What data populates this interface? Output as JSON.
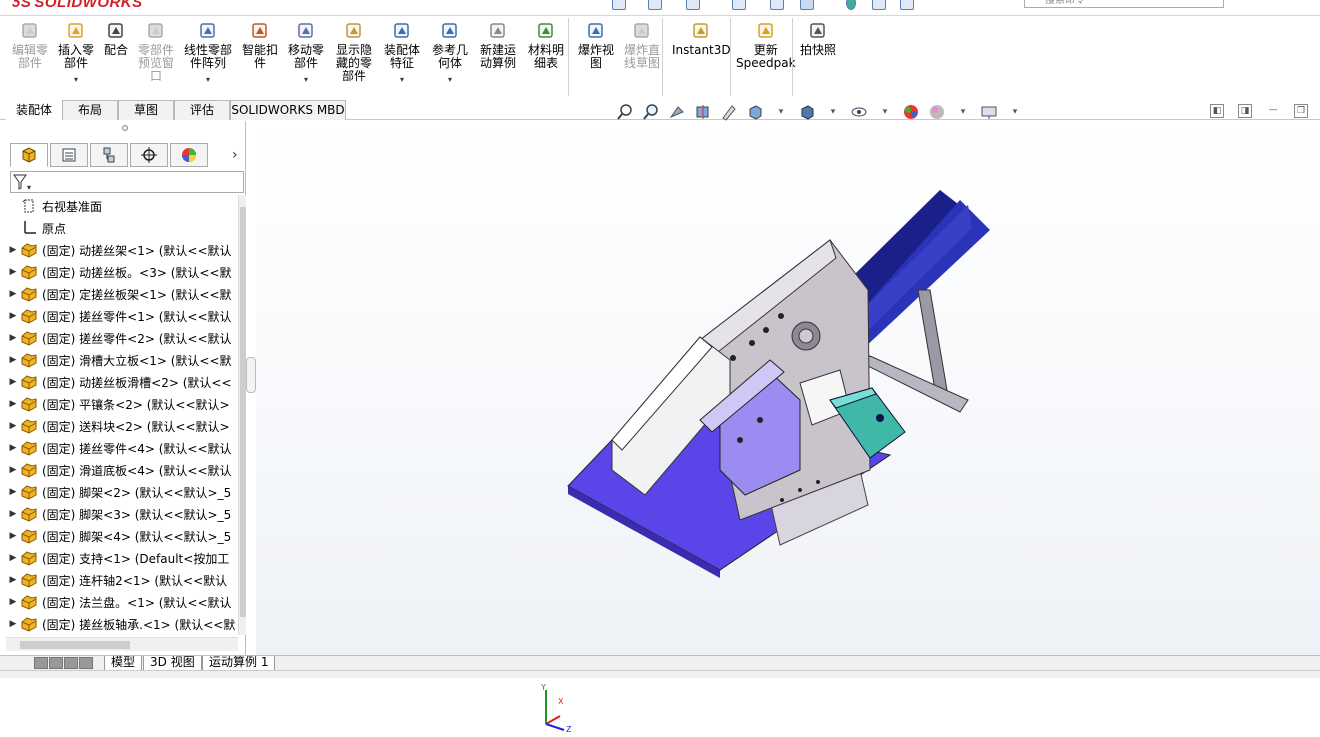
{
  "app": {
    "name": "SOLIDWORKS",
    "search_placeholder": "搜索命令"
  },
  "toolbar": {
    "items": [
      {
        "label_lines": [
          "编辑零",
          "部件"
        ],
        "disabled": true,
        "icon": "edit-component-icon"
      },
      {
        "label_lines": [
          "插入零",
          "部件"
        ],
        "disabled": false,
        "icon": "insert-component-icon",
        "dropdown": true
      },
      {
        "label_lines": [
          "配合"
        ],
        "disabled": false,
        "icon": "mate-icon"
      },
      {
        "label_lines": [
          "零部件",
          "预览窗",
          "口"
        ],
        "disabled": true,
        "icon": "component-preview-icon"
      },
      {
        "label_lines": [
          "线性零部",
          "件阵列"
        ],
        "disabled": false,
        "icon": "linear-pattern-icon",
        "dropdown": true
      },
      {
        "label_lines": [
          "智能扣",
          "件"
        ],
        "disabled": false,
        "icon": "smart-fasteners-icon"
      },
      {
        "label_lines": [
          "移动零",
          "部件"
        ],
        "disabled": false,
        "icon": "move-component-icon",
        "dropdown": true
      },
      {
        "label_lines": [
          "显示隐",
          "藏的零",
          "部件"
        ],
        "disabled": false,
        "icon": "show-hidden-icon"
      },
      {
        "label_lines": [
          "装配体",
          "特征"
        ],
        "disabled": false,
        "icon": "assembly-features-icon",
        "dropdown": true
      },
      {
        "label_lines": [
          "参考几",
          "何体"
        ],
        "disabled": false,
        "icon": "reference-geometry-icon",
        "dropdown": true
      },
      {
        "label_lines": [
          "新建运",
          "动算例"
        ],
        "disabled": false,
        "icon": "new-motion-study-icon"
      },
      {
        "label_lines": [
          "材料明",
          "细表"
        ],
        "disabled": false,
        "icon": "bom-icon"
      },
      {
        "label_lines": [
          "爆炸视",
          "图"
        ],
        "disabled": false,
        "icon": "exploded-view-icon"
      },
      {
        "label_lines": [
          "爆炸直",
          "线草图"
        ],
        "disabled": true,
        "icon": "explode-line-sketch-icon"
      },
      {
        "label_lines": [
          "Instant3D"
        ],
        "disabled": false,
        "icon": "instant3d-icon"
      },
      {
        "label_lines": [
          "更新",
          "Speedpak"
        ],
        "disabled": false,
        "icon": "speedpak-icon"
      },
      {
        "label_lines": [
          "拍快照"
        ],
        "disabled": false,
        "icon": "snapshot-icon"
      }
    ]
  },
  "command_tabs": [
    "装配体",
    "布局",
    "草图",
    "评估",
    "SOLIDWORKS MBD"
  ],
  "feature_tree": {
    "items": [
      {
        "label": "右视基准面",
        "icon": "plane-icon",
        "expandable": false
      },
      {
        "label": "原点",
        "icon": "origin-icon",
        "expandable": false
      },
      {
        "label": "(固定) 动搓丝架<1> (默认<<默认",
        "icon": "part-icon",
        "expandable": true
      },
      {
        "label": "(固定) 动搓丝板。<3> (默认<<默",
        "icon": "part-icon",
        "expandable": true
      },
      {
        "label": "(固定) 定搓丝板架<1> (默认<<默",
        "icon": "part-icon",
        "expandable": true
      },
      {
        "label": "(固定) 搓丝零件<1> (默认<<默认",
        "icon": "part-icon",
        "expandable": true
      },
      {
        "label": "(固定) 搓丝零件<2> (默认<<默认",
        "icon": "part-icon",
        "expandable": true
      },
      {
        "label": "(固定) 滑槽大立板<1> (默认<<默",
        "icon": "part-icon",
        "expandable": true
      },
      {
        "label": "(固定) 动搓丝板滑槽<2> (默认<<",
        "icon": "part-icon",
        "expandable": true
      },
      {
        "label": "(固定) 平镶条<2> (默认<<默认>",
        "icon": "part-icon",
        "expandable": true
      },
      {
        "label": "(固定) 送料块<2> (默认<<默认>",
        "icon": "part-icon",
        "expandable": true
      },
      {
        "label": "(固定) 搓丝零件<4> (默认<<默认",
        "icon": "part-icon",
        "expandable": true
      },
      {
        "label": "(固定) 滑道底板<4> (默认<<默认",
        "icon": "part-icon",
        "expandable": true
      },
      {
        "label": "(固定) 脚架<2> (默认<<默认>_5",
        "icon": "part-icon",
        "expandable": true
      },
      {
        "label": "(固定) 脚架<3> (默认<<默认>_5",
        "icon": "part-icon",
        "expandable": true
      },
      {
        "label": "(固定) 脚架<4> (默认<<默认>_5",
        "icon": "part-icon",
        "expandable": true
      },
      {
        "label": "(固定) 支持<1> (Default<按加工",
        "icon": "part-icon",
        "expandable": true
      },
      {
        "label": "(固定) 连杆轴2<1> (默认<<默认",
        "icon": "part-icon",
        "expandable": true
      },
      {
        "label": "(固定) 法兰盘。<1> (默认<<默认",
        "icon": "part-icon",
        "expandable": true
      },
      {
        "label": "(固定) 搓丝板轴承.<1> (默认<<默",
        "icon": "part-icon",
        "expandable": true
      }
    ]
  },
  "bottom_tabs": [
    "模型",
    "3D 视图",
    "运动算例 1"
  ],
  "colors": {
    "accent": "#d31f26",
    "tree_part": "#f0b323",
    "model_blue": "#1a1f8a",
    "model_purple": "#6a4de0",
    "model_teal": "#3fb8a8"
  }
}
